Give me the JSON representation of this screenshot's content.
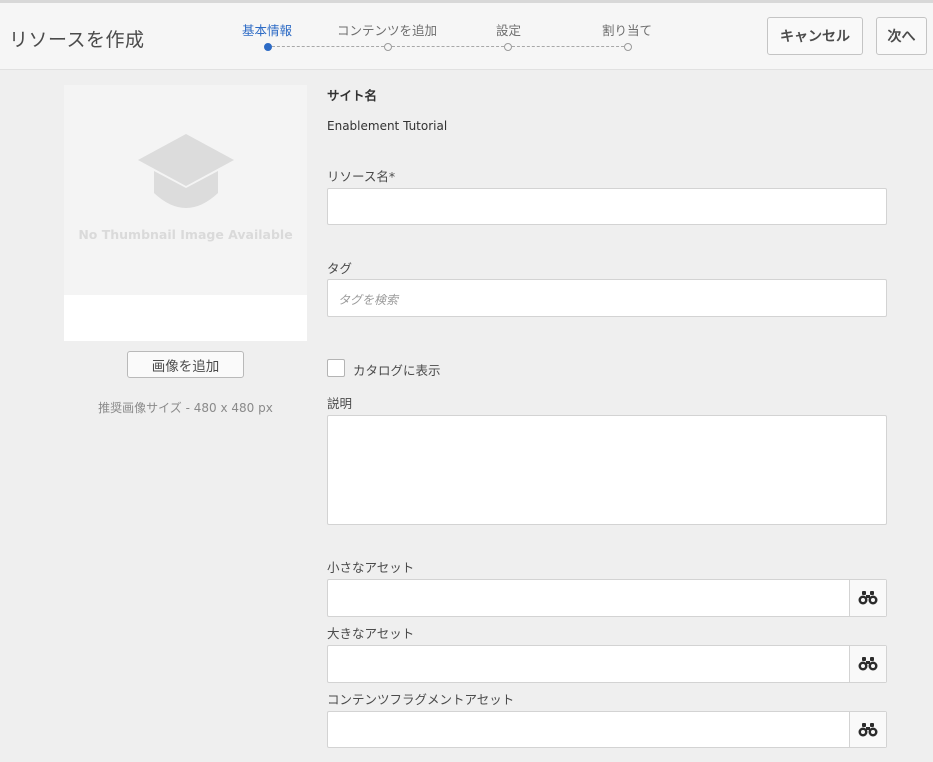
{
  "header": {
    "title": "リソースを作成",
    "steps": [
      {
        "label": "基本情報",
        "active": true
      },
      {
        "label": "コンテンツを追加",
        "active": false
      },
      {
        "label": "設定",
        "active": false
      },
      {
        "label": "割り当て",
        "active": false
      }
    ],
    "cancel_label": "キャンセル",
    "next_label": "次へ",
    "accent_color": "#2d6bc5"
  },
  "thumbnail": {
    "placeholder_text": "No Thumbnail Image Available",
    "add_image_label": "画像を追加",
    "recommended_size": "推奨画像サイズ - 480  x  480 px"
  },
  "form": {
    "site_name_label": "サイト名",
    "site_name_value": "Enablement Tutorial",
    "resource_name_label": "リソース名*",
    "resource_name_value": "",
    "tags_label": "タグ",
    "tags_placeholder": "タグを検索",
    "show_in_catalog_label": "カタログに表示",
    "show_in_catalog_checked": false,
    "description_label": "説明",
    "description_value": "",
    "small_asset_label": "小さなアセット",
    "large_asset_label": "大きなアセット",
    "content_fragment_label": "コンテンツフラグメントアセット",
    "picker_icon": "binoculars-icon"
  }
}
